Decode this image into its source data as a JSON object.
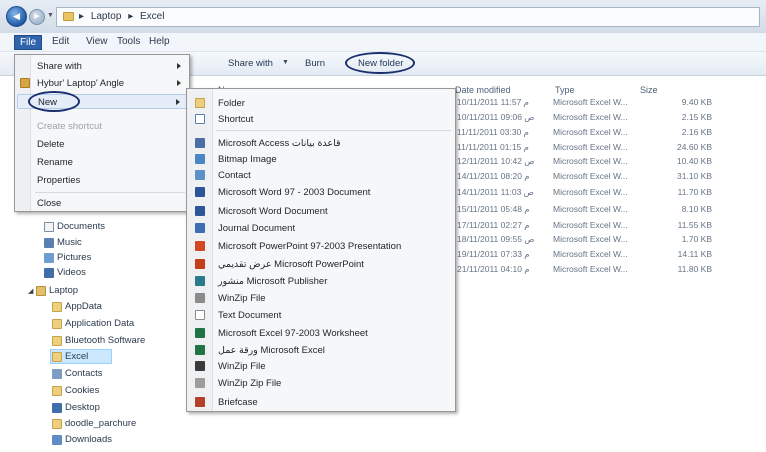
{
  "window": {
    "breadcrumb_separator": "▸",
    "breadcrumb": [
      "Laptop",
      "Excel"
    ]
  },
  "menubar": {
    "file": "File",
    "edit": "Edit",
    "view": "View",
    "tools": "Tools",
    "help": "Help"
  },
  "toolbar": {
    "share_with": "Share with",
    "burn": "Burn",
    "new_folder": "New folder"
  },
  "columns": {
    "name": "Name",
    "date_modified": "Date modified",
    "type": "Type",
    "size": "Size"
  },
  "file_menu": {
    "items": [
      {
        "label": "Share with",
        "has_submenu": true
      },
      {
        "label": "Hybur' Laptop' Angle",
        "has_submenu": true,
        "icon": "program-icon"
      },
      {
        "label": "New",
        "has_submenu": true,
        "highlighted": true
      },
      {
        "label": "Create shortcut",
        "disabled": true
      },
      {
        "label": "Delete"
      },
      {
        "label": "Rename"
      },
      {
        "label": "Properties"
      },
      {
        "label": "Close"
      }
    ]
  },
  "new_submenu": {
    "items": [
      {
        "label": "Folder",
        "icon": "folder-icon"
      },
      {
        "label": "Shortcut",
        "icon": "shortcut-icon"
      },
      {
        "label": "Microsoft Access قاعدة بيانات",
        "icon": "access-icon"
      },
      {
        "label": "Bitmap Image",
        "icon": "bitmap-icon"
      },
      {
        "label": "Contact",
        "icon": "contact-icon"
      },
      {
        "label": "Microsoft Word 97 - 2003 Document",
        "icon": "word-icon"
      },
      {
        "label": "Microsoft Word Document",
        "icon": "word-icon"
      },
      {
        "label": "Journal Document",
        "icon": "journal-icon"
      },
      {
        "label": "Microsoft PowerPoint 97-2003 Presentation",
        "icon": "powerpoint-icon"
      },
      {
        "label": "عرض تقديمي Microsoft PowerPoint",
        "icon": "powerpoint-icon"
      },
      {
        "label": "منشور Microsoft Publisher",
        "icon": "publisher-icon"
      },
      {
        "label": "WinZip File",
        "icon": "winzip-icon"
      },
      {
        "label": "Text Document",
        "icon": "text-document-icon"
      },
      {
        "label": "Microsoft Excel 97-2003 Worksheet",
        "icon": "excel-icon"
      },
      {
        "label": "ورقة عمل Microsoft Excel",
        "icon": "excel-icon"
      },
      {
        "label": "WinZip File",
        "icon": "winzip-icon"
      },
      {
        "label": "WinZip Zip File",
        "icon": "winzip-icon"
      },
      {
        "label": "Briefcase",
        "icon": "briefcase-icon"
      }
    ]
  },
  "nav": {
    "items": [
      {
        "label": "Documents",
        "icon": "documents-icon"
      },
      {
        "label": "Music",
        "icon": "music-icon"
      },
      {
        "label": "Pictures",
        "icon": "pictures-icon"
      },
      {
        "label": "Videos",
        "icon": "videos-icon"
      },
      {
        "label": "Laptop",
        "icon": "user-folder-icon"
      },
      {
        "label": "AppData",
        "icon": "folder-icon"
      },
      {
        "label": "Application Data",
        "icon": "folder-icon"
      },
      {
        "label": "Bluetooth Software",
        "icon": "folder-icon"
      },
      {
        "label": "Excel",
        "icon": "folder-icon",
        "selected": true
      },
      {
        "label": "Contacts",
        "icon": "contacts-icon"
      },
      {
        "label": "Cookies",
        "icon": "folder-icon"
      },
      {
        "label": "Desktop",
        "icon": "desktop-icon"
      },
      {
        "label": "doodle_parchure",
        "icon": "folder-icon"
      },
      {
        "label": "Downloads",
        "icon": "downloads-icon"
      }
    ]
  },
  "files": [
    {
      "date": "10/11/2011 م 11:57",
      "type": "Microsoft Excel W...",
      "size": "9.40 KB"
    },
    {
      "date": "10/11/2011 ص 09:06",
      "type": "Microsoft Excel W...",
      "size": "2.15 KB"
    },
    {
      "date": "11/11/2011 م 03:30",
      "type": "Microsoft Excel W...",
      "size": "2.16 KB"
    },
    {
      "date": "11/11/2011 م 01:15",
      "type": "Microsoft Excel W...",
      "size": "24.60 KB"
    },
    {
      "date": "12/11/2011 ص 10:42",
      "type": "Microsoft Excel W...",
      "size": "10.40 KB"
    },
    {
      "date": "14/11/2011 م 08:20",
      "type": "Microsoft Excel W...",
      "size": "31.10 KB"
    },
    {
      "date": "14/11/2011 ص 11:03",
      "type": "Microsoft Excel W...",
      "size": "11.70 KB"
    },
    {
      "date": "15/11/2011 م 05:48",
      "type": "Microsoft Excel W...",
      "size": "8.10 KB"
    },
    {
      "date": "17/11/2011 م 02:27",
      "type": "Microsoft Excel W...",
      "size": "11.55 KB"
    },
    {
      "date": "18/11/2011 ص 09:55",
      "type": "Microsoft Excel W...",
      "size": "1.70 KB"
    },
    {
      "date": "19/11/2011 م 07:33",
      "type": "Microsoft Excel W...",
      "size": "14.11 KB"
    },
    {
      "date": "21/11/2011 م 04:10",
      "type": "Microsoft Excel W...",
      "size": "11.80 KB"
    }
  ],
  "colors": {
    "menu_accent": "#3064ad",
    "selection": "#cce8ff",
    "annotation_circle": "#1a2f6e"
  }
}
